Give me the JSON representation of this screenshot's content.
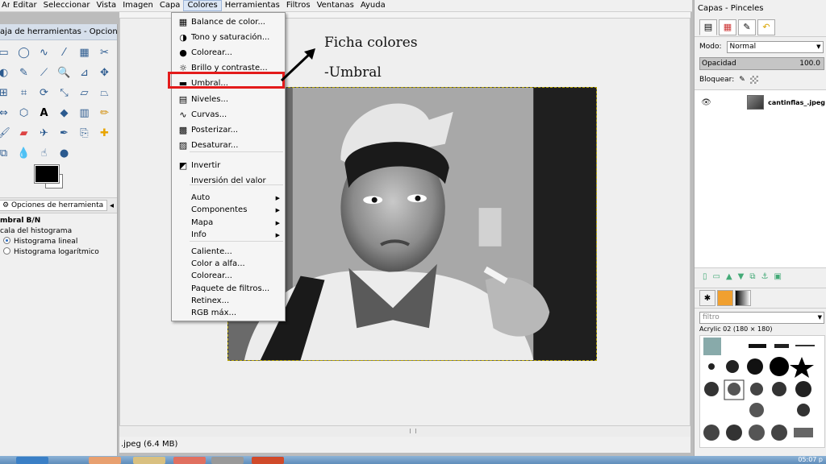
{
  "menubar": {
    "items": [
      "Archivo",
      "Editar",
      "Seleccionar",
      "Vista",
      "Imagen",
      "Capa",
      "Colores",
      "Herramientas",
      "Filtros",
      "Ventanas",
      "Ayuda"
    ],
    "active": "Colores"
  },
  "toolbox": {
    "title": "aja de herramientas - Opcion...",
    "options_tab": "Opciones de herramienta",
    "tool_name": "mbral B/N",
    "hist_scale": "cala del histograma",
    "linear": "Histograma lineal",
    "log": "Histograma logarítmico"
  },
  "colores_menu": {
    "items": [
      {
        "label": "Balance de color...",
        "icon": "color-balance-icon"
      },
      {
        "label": "Tono y saturación...",
        "icon": "hue-saturation-icon"
      },
      {
        "label": "Colorear...",
        "icon": "colorize-icon"
      },
      {
        "label": "Brillo y contraste...",
        "icon": "brightness-icon"
      },
      {
        "label": "Umbral...",
        "icon": "threshold-icon"
      },
      {
        "label": "Niveles...",
        "icon": "levels-icon"
      },
      {
        "label": "Curvas...",
        "icon": "curves-icon"
      },
      {
        "label": "Posterizar...",
        "icon": "posterize-icon"
      },
      {
        "label": "Desaturar...",
        "icon": "desaturate-icon"
      },
      {
        "label": "Invertir",
        "icon": "invert-icon"
      },
      {
        "label": "Inversión del valor",
        "icon": ""
      },
      {
        "label": "Auto",
        "submenu": true
      },
      {
        "label": "Componentes",
        "submenu": true
      },
      {
        "label": "Mapa",
        "submenu": true
      },
      {
        "label": "Info",
        "submenu": true
      },
      {
        "label": "Caliente...",
        "icon": ""
      },
      {
        "label": "Color a alfa...",
        "icon": ""
      },
      {
        "label": "Colorear...",
        "icon": ""
      },
      {
        "label": "Paquete de filtros...",
        "icon": ""
      },
      {
        "label": "Retinex...",
        "icon": ""
      },
      {
        "label": "RGB máx...",
        "icon": ""
      }
    ]
  },
  "annotation": {
    "line1": "Ficha colores",
    "line2": "-Umbral",
    "highlight_color": "#e31b1b"
  },
  "status": {
    "file": ".jpeg (6.4 MB)"
  },
  "dock": {
    "title": "Capas - Pinceles",
    "mode_label": "Modo:",
    "mode_value": "Normal",
    "opacity_label": "Opacidad",
    "opacity_value": "100.0",
    "lock_label": "Bloquear:",
    "layer_name": "cantinflas_.jpeg",
    "filter_placeholder": "filtro",
    "brush_name": "Acrylic 02 (180 × 180)"
  },
  "taskbar": {
    "clock": "05:07 p"
  }
}
